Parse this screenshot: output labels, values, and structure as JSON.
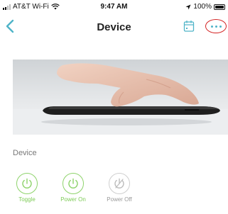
{
  "status_bar": {
    "carrier": "AT&T Wi-Fi",
    "time": "9:47 AM",
    "battery_text": "100%"
  },
  "nav": {
    "title": "Device",
    "back_icon": "chevron-left-icon",
    "calendar_icon": "calendar-icon",
    "more_icon": "ellipsis-icon"
  },
  "section": {
    "label": "Device"
  },
  "actions": [
    {
      "label": "Toggle",
      "icon": "power-icon",
      "state": "active"
    },
    {
      "label": "Power On",
      "icon": "power-icon",
      "state": "active"
    },
    {
      "label": "Power Off",
      "icon": "power-off-icon",
      "state": "inactive"
    }
  ],
  "colors": {
    "accent": "#4fb4c8",
    "active_green": "#7ecb57",
    "highlight_red": "#d32222",
    "inactive_gray": "#999999"
  }
}
